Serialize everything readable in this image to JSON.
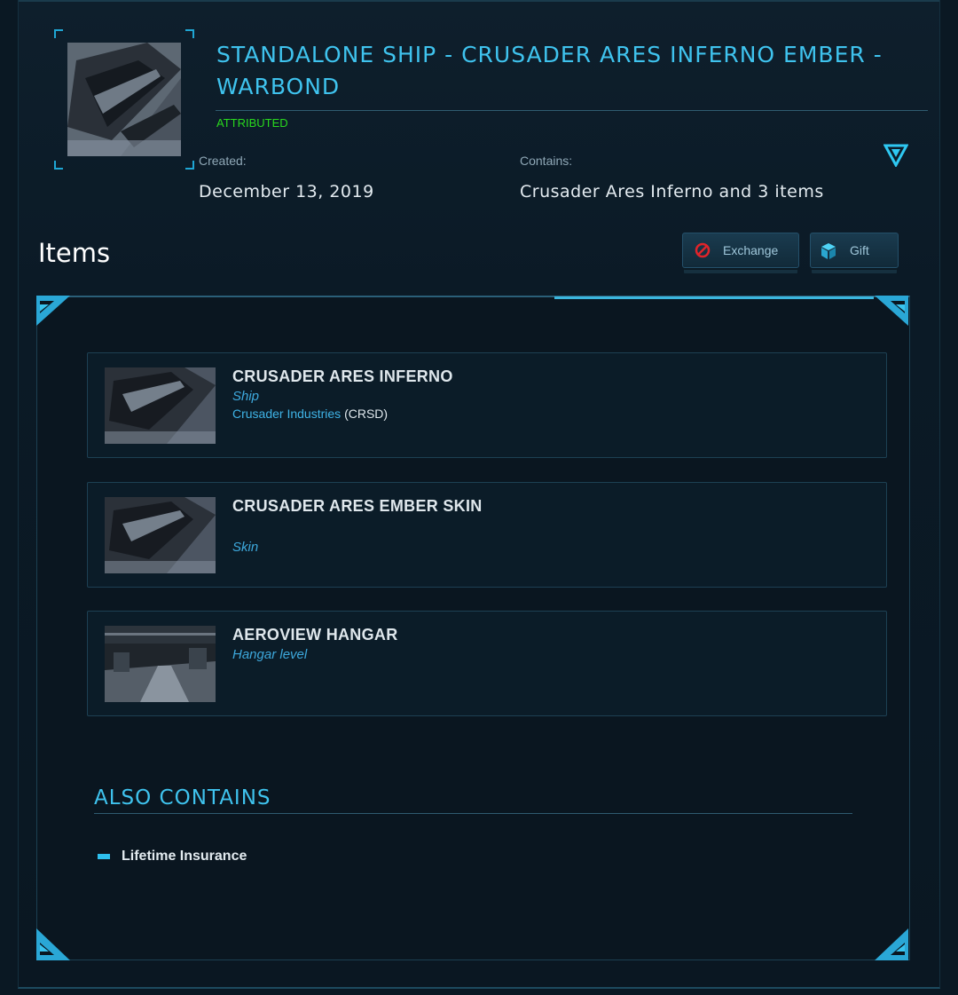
{
  "pledge": {
    "title": "STANDALONE SHIP - CRUSADER ARES INFERNO EMBER - WARBOND",
    "status": "ATTRIBUTED",
    "created_label": "Created:",
    "created_value": "December 13, 2019",
    "contains_label": "Contains:",
    "contains_value": "Crusader Ares Inferno and 3 items"
  },
  "items_section": {
    "title": "Items",
    "exchange_label": "Exchange",
    "gift_label": "Gift"
  },
  "items": [
    {
      "name": "CRUSADER ARES INFERNO",
      "type": "Ship",
      "maker": "Crusader Industries",
      "maker_code": "(CRSD)"
    },
    {
      "name": "CRUSADER ARES EMBER SKIN",
      "type": "Skin"
    },
    {
      "name": "AEROVIEW HANGAR",
      "type": "Hangar level"
    }
  ],
  "also_contains": {
    "title": "ALSO CONTAINS",
    "items": [
      "Lifetime Insurance"
    ]
  },
  "colors": {
    "accent": "#3fc3ee",
    "status_green": "#29d81e",
    "exchange_red": "#e0242a",
    "background": "#0a1823"
  },
  "icons": [
    "toggle-triangle-icon",
    "exchange-prohibited-icon",
    "gift-cube-icon"
  ]
}
